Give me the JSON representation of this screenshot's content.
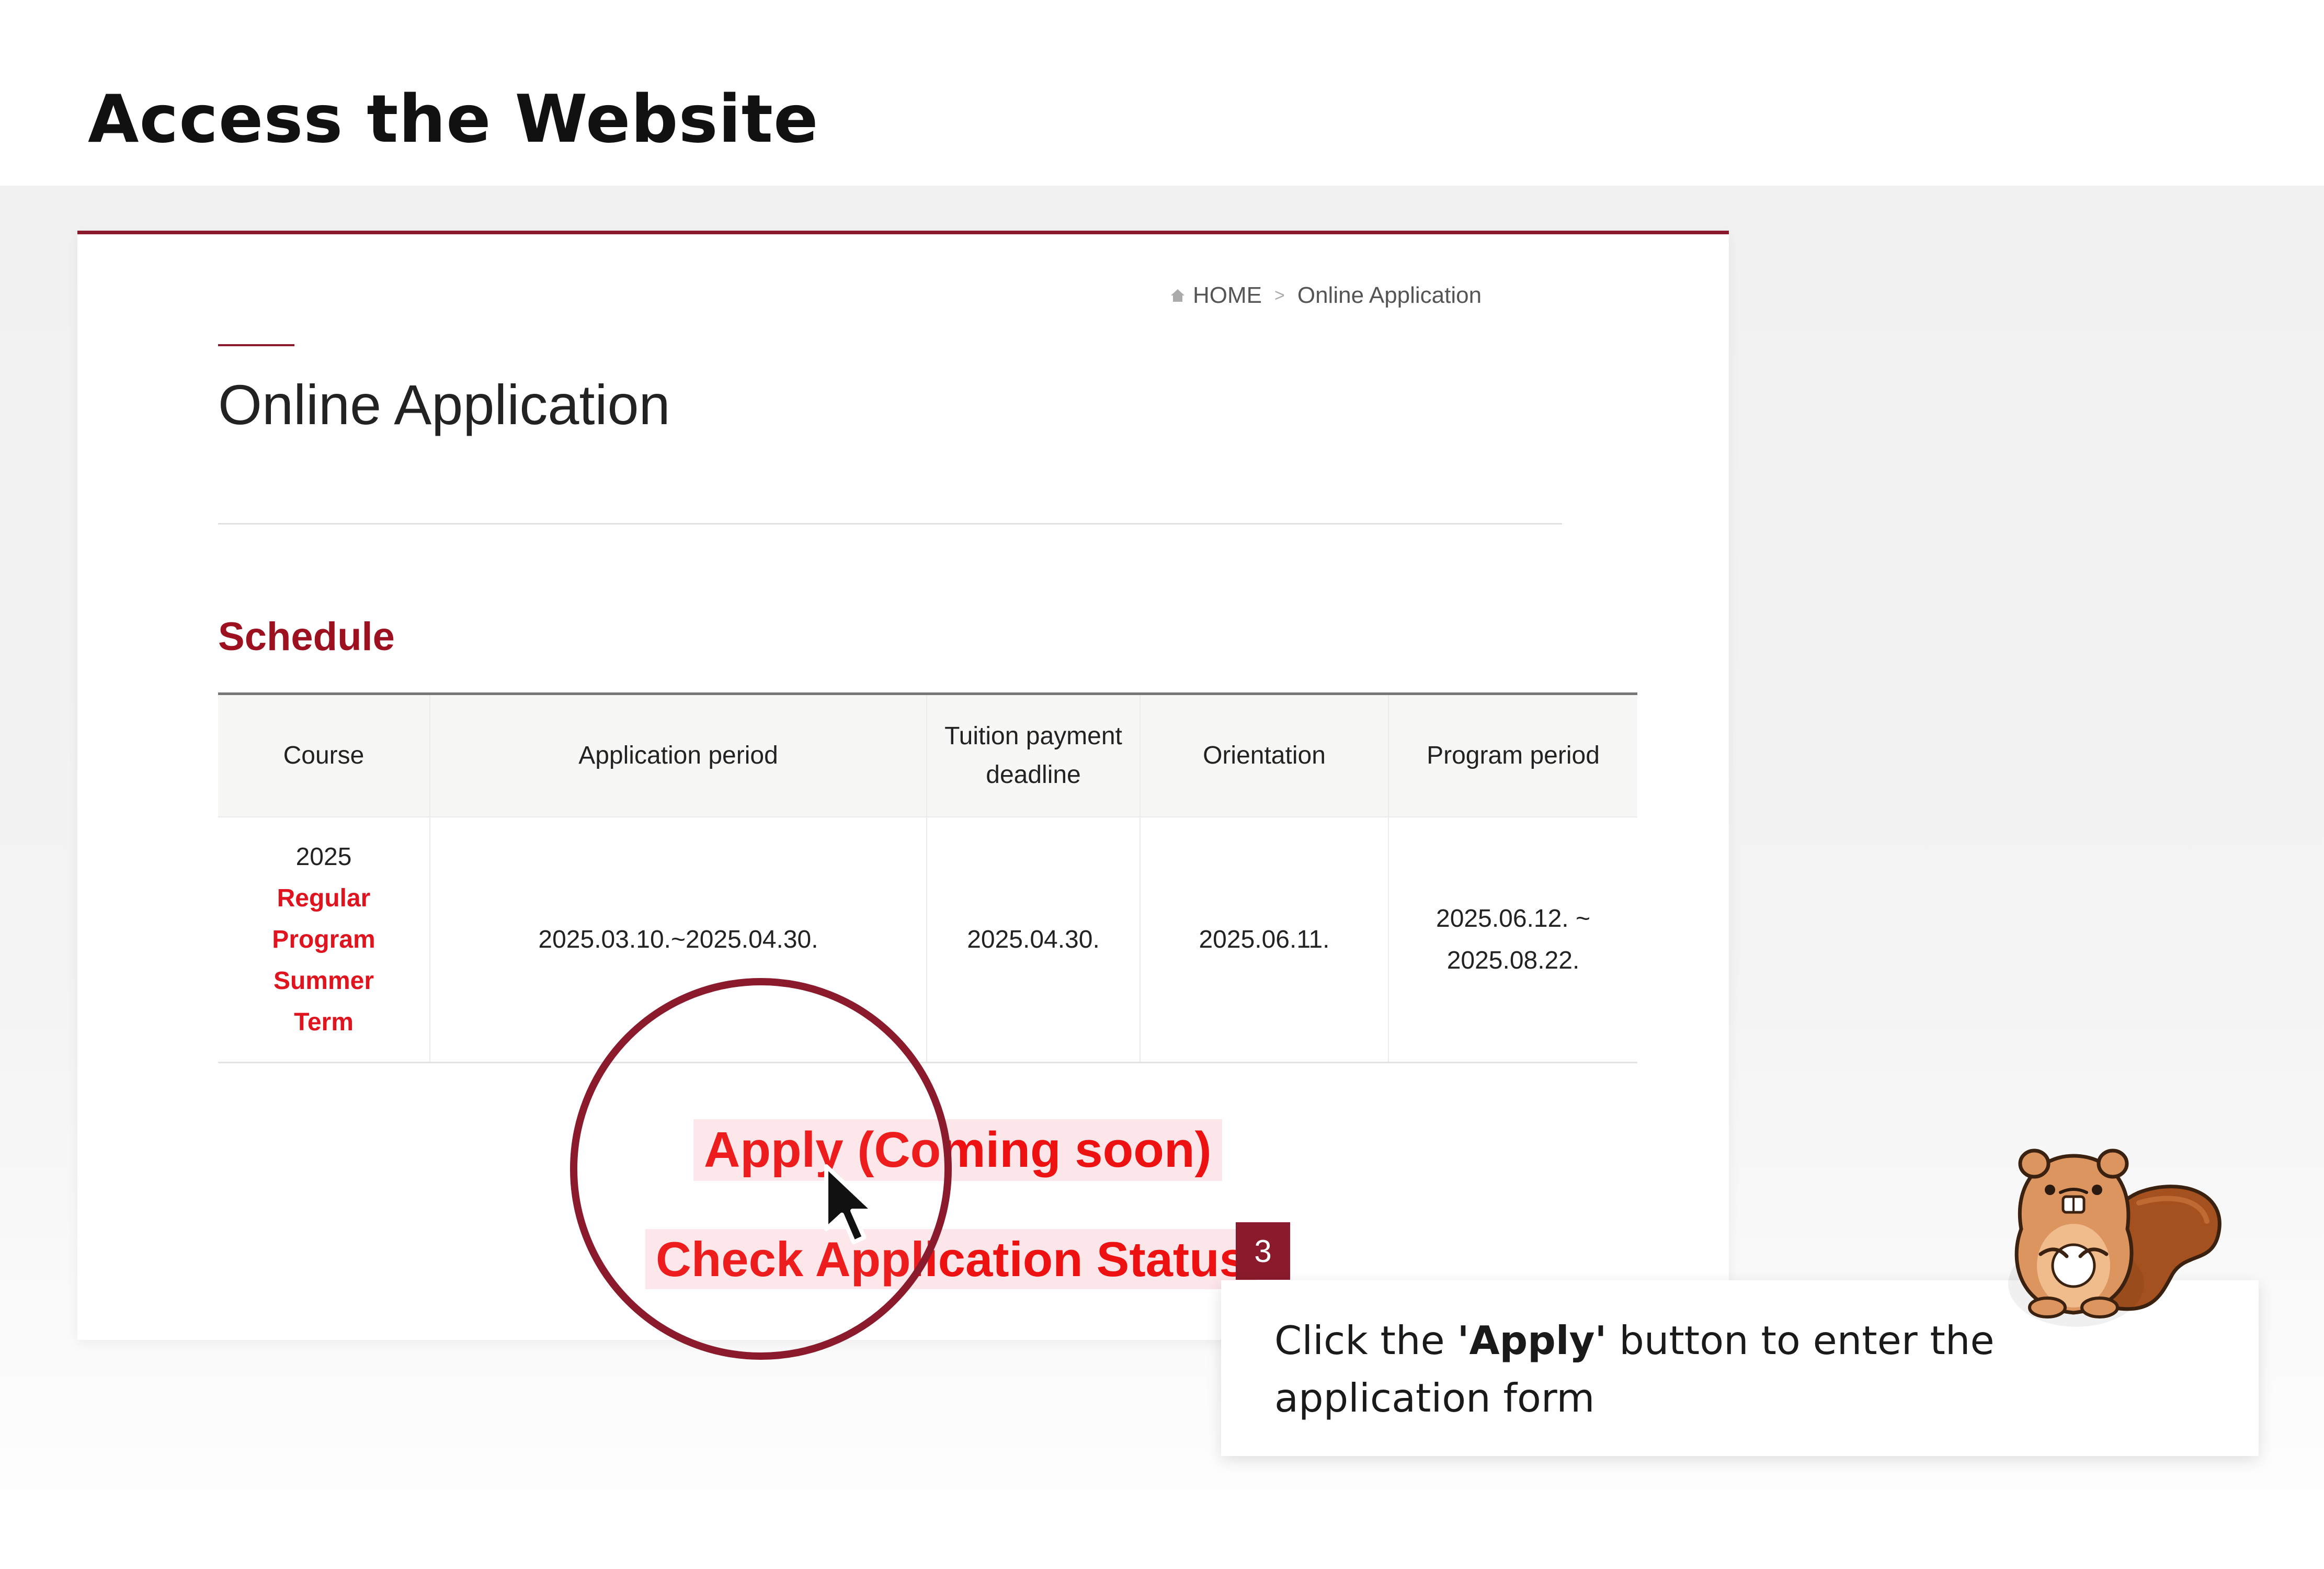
{
  "page": {
    "heading": "Access the Website"
  },
  "breadcrumb": {
    "home": "HOME",
    "current": "Online Application"
  },
  "main": {
    "title": "Online Application",
    "section_title": "Schedule"
  },
  "table": {
    "headers": {
      "course": "Course",
      "application_period": "Application period",
      "tuition_line1": "Tuition payment",
      "tuition_line2": "deadline",
      "orientation": "Orientation",
      "program_period": "Program period"
    },
    "row": {
      "course_year": "2025",
      "course_line1": "Regular",
      "course_line2": "Program",
      "course_line3": "Summer",
      "course_line4": "Term",
      "application_period": "2025.03.10.~2025.04.30.",
      "tuition_deadline": "2025.04.30.",
      "orientation": "2025.06.11.",
      "program_period_line1": "2025.06.12. ~",
      "program_period_line2": "2025.08.22."
    }
  },
  "buttons": {
    "apply_label": "Apply (Coming soon)",
    "status_label": "Check Application Status"
  },
  "tutorial": {
    "step": "3",
    "text_before": "Click the ",
    "text_bold": "'Apply'",
    "text_after": " button to enter the application form"
  },
  "colors": {
    "accent": "#8a1a2c",
    "highlight_red": "#e0141e",
    "button_bg": "#fde6e9"
  },
  "icons": {
    "home": "home-icon",
    "cursor": "cursor-arrow-icon",
    "mascot": "squirrel-mascot-icon"
  }
}
